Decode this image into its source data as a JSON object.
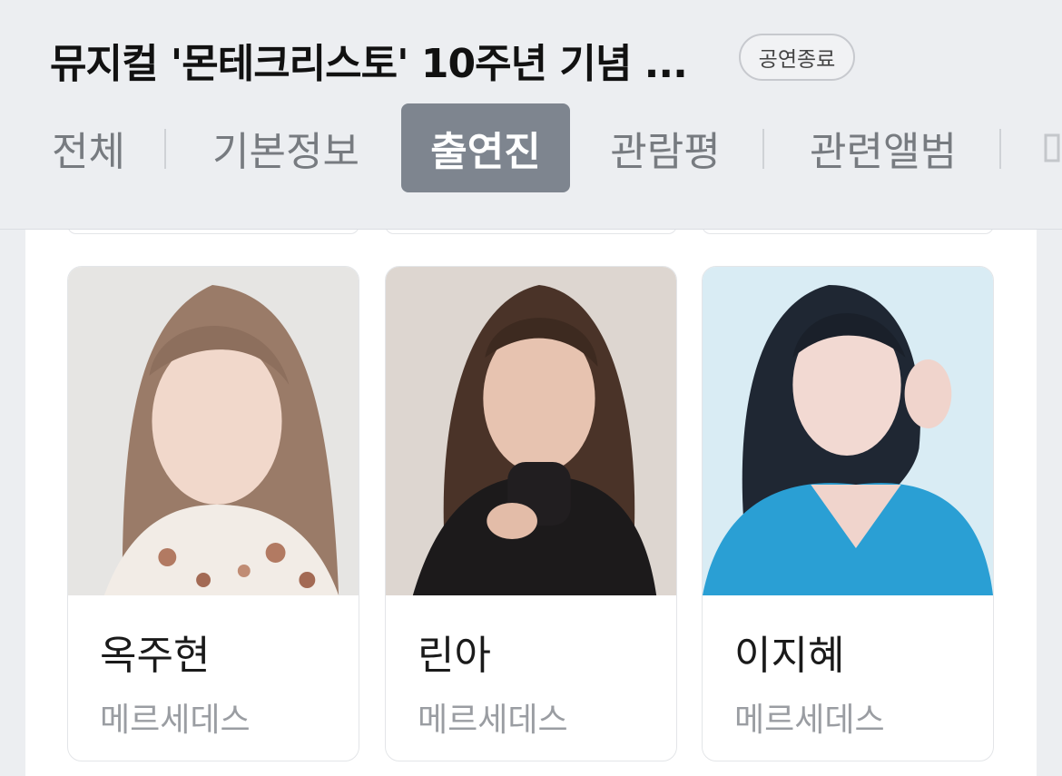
{
  "header": {
    "title": "뮤지컬 '몬테크리스토' 10주년 기념 ...",
    "status_badge": "공연종료"
  },
  "tabs": [
    {
      "label": "전체",
      "active": false
    },
    {
      "label": "기본정보",
      "active": false
    },
    {
      "label": "출연진",
      "active": true
    },
    {
      "label": "관람평",
      "active": false
    },
    {
      "label": "관련앨범",
      "active": false
    }
  ],
  "cast": [
    {
      "name": "옥주현",
      "role": "메르세데스"
    },
    {
      "name": "린아",
      "role": "메르세데스"
    },
    {
      "name": "이지혜",
      "role": "메르세데스"
    }
  ],
  "colors": {
    "active_tab_bg": "#7e858f",
    "background": "#eceef1"
  }
}
